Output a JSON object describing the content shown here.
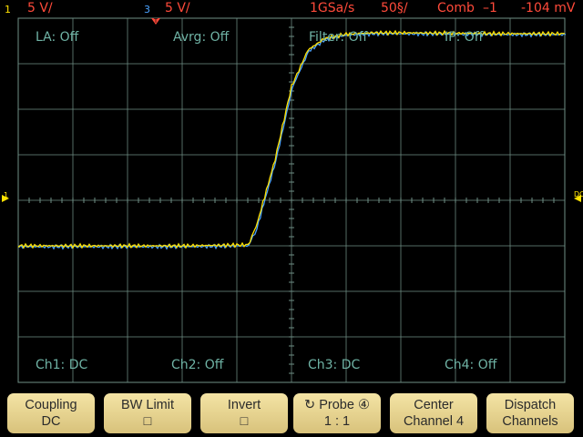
{
  "header": {
    "ch1_number": "1",
    "ch1_scale": "5 V/",
    "ch3_number": "3",
    "ch3_scale": "5 V/",
    "sample_rate": "1GSa/s",
    "timebase": "50§/",
    "acq_mode": "Comb",
    "trigger_source": "–1",
    "trigger_level": "-104 mV"
  },
  "grid_labels": {
    "la": "LA: Off",
    "avrg": "Avrg: Off",
    "filter": "Filter: Off",
    "ip": "IP: Off",
    "ch1": "Ch1: DC",
    "ch2": "Ch2: Off",
    "ch3": "Ch3: DC",
    "ch4": "Ch4: Off"
  },
  "markers": {
    "ground_left": "1",
    "coupling_right": "DC"
  },
  "softkeys": [
    {
      "line1": "Coupling",
      "line2": "DC"
    },
    {
      "line1": "BW Limit",
      "line2": "□"
    },
    {
      "line1": "Invert",
      "line2": "□"
    },
    {
      "line1": "Probe ④",
      "line2": "1 : 1",
      "icon": "rotate-knob-icon"
    },
    {
      "line1": "Center",
      "line2": "Channel 4"
    },
    {
      "line1": "Dispatch",
      "line2": "Channels"
    }
  ],
  "colors": {
    "ch1": "#ffe200",
    "ch3": "#4aa3ff",
    "status": "#ff4a3a",
    "grid": "#6f8f86",
    "labels": "#6fb3a5",
    "softkey": "#e6d18e"
  },
  "chart_data": {
    "type": "line",
    "title": "",
    "xlabel": "",
    "ylabel": "",
    "x_divisions": 10,
    "y_divisions": 8,
    "ylim_div": [
      -4,
      4
    ],
    "series": [
      {
        "color": "#ffe200",
        "x_div": [
          0,
          1,
          2,
          3,
          4.2,
          4.35,
          4.7,
          5.0,
          5.3,
          5.6,
          6.0,
          6.5,
          7.0,
          8,
          9,
          10
        ],
        "y_div": [
          -1.0,
          -1.0,
          -1.0,
          -1.0,
          -0.98,
          -0.6,
          0.9,
          2.5,
          3.3,
          3.55,
          3.65,
          3.68,
          3.68,
          3.67,
          3.66,
          3.66
        ]
      },
      {
        "color": "#4aa3ff",
        "x_div": [
          0,
          1,
          2,
          3,
          4.2,
          4.35,
          4.7,
          5.0,
          5.3,
          5.6,
          6.0,
          6.5,
          7.0,
          8,
          9,
          10
        ],
        "y_div": [
          -1.0,
          -1.0,
          -1.0,
          -1.0,
          -0.98,
          -0.6,
          0.9,
          2.5,
          3.3,
          3.55,
          3.65,
          3.68,
          3.68,
          3.67,
          3.66,
          3.66
        ]
      }
    ]
  }
}
